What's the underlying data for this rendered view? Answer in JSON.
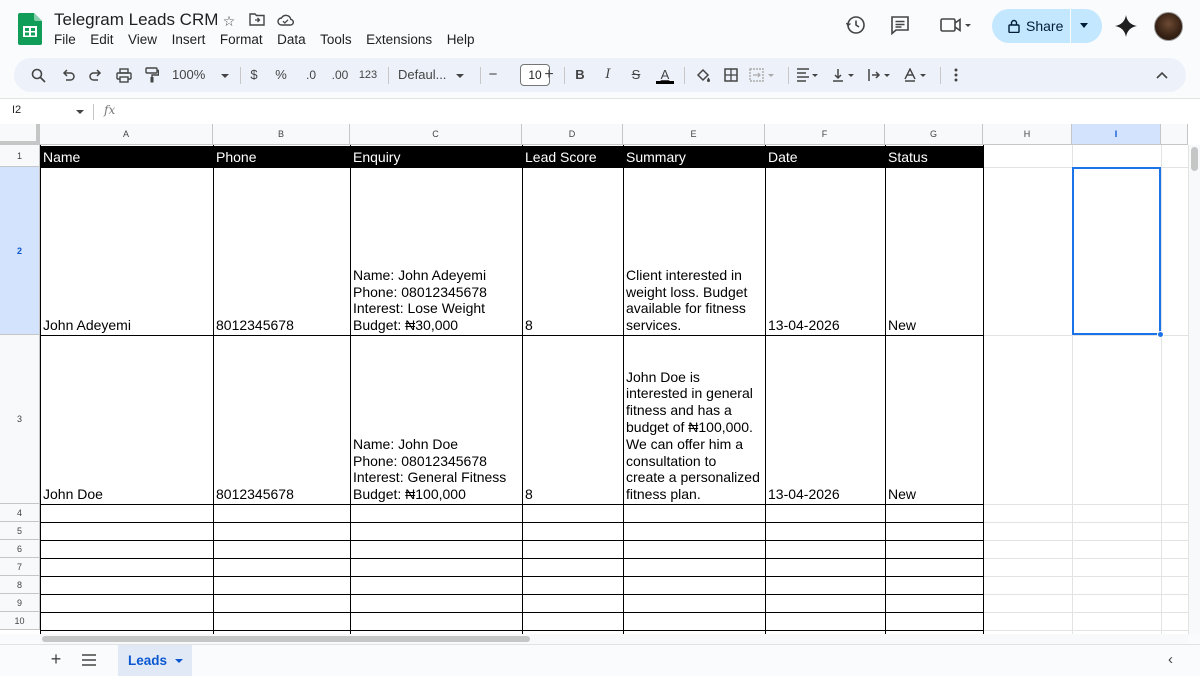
{
  "app": {
    "title": "Telegram Leads CRM",
    "menu": [
      "File",
      "Edit",
      "View",
      "Insert",
      "Format",
      "Data",
      "Tools",
      "Extensions",
      "Help"
    ],
    "share_label": "Share",
    "brand_color": "#0f9d58",
    "share_color": "#c2e7ff"
  },
  "toolbar": {
    "zoom": "100%",
    "currency": "$",
    "percent": "%",
    "dec_decrease": ".0",
    "dec_increase": ".00",
    "number_format": "123",
    "font": "Defaul...",
    "font_size": "10",
    "minus": "−",
    "plus": "+",
    "bold": "B",
    "italic": "I",
    "strike": "S",
    "text_color": "A"
  },
  "formula_bar": {
    "cell_ref": "I2",
    "fx": "fx"
  },
  "columns": [
    "A",
    "B",
    "C",
    "D",
    "E",
    "F",
    "G",
    "H",
    "I"
  ],
  "rows": [
    "1",
    "2",
    "3",
    "4",
    "5",
    "6",
    "7",
    "8",
    "9",
    "10"
  ],
  "headers": [
    "Name",
    "Phone",
    "Enquiry",
    "Lead Score",
    "Summary",
    "Date",
    "Status"
  ],
  "data_rows": [
    {
      "name": "John Adeyemi",
      "phone": "8012345678",
      "enquiry": "Name: John Adeyemi\nPhone: 08012345678\nInterest: Lose Weight\nBudget: ₦30,000",
      "lead_score": "8",
      "summary": "Client interested in\nweight loss. Budget\navailable for fitness\nservices.",
      "date": "13-04-2026",
      "status": "New"
    },
    {
      "name": "John Doe",
      "phone": "8012345678",
      "enquiry": "Name: John Doe\nPhone: 08012345678\nInterest: General Fitness\nBudget: ₦100,000",
      "lead_score": "8",
      "summary": "John Doe is\ninterested in general\nfitness and has a\nbudget of ₦100,000.\nWe can offer him a\nconsultation to\ncreate a personalized\nfitness plan.",
      "date": "13-04-2026",
      "status": "New"
    }
  ],
  "sheet_tabs": [
    {
      "label": "Leads",
      "active": true
    }
  ],
  "icons": {
    "star": "star-icon",
    "move": "move-to-folder-icon",
    "cloud": "cloud-status-icon",
    "history": "history-icon",
    "comments": "comments-icon",
    "meet": "meet-icon",
    "lock": "lock-icon",
    "gemini": "gemini-icon"
  }
}
